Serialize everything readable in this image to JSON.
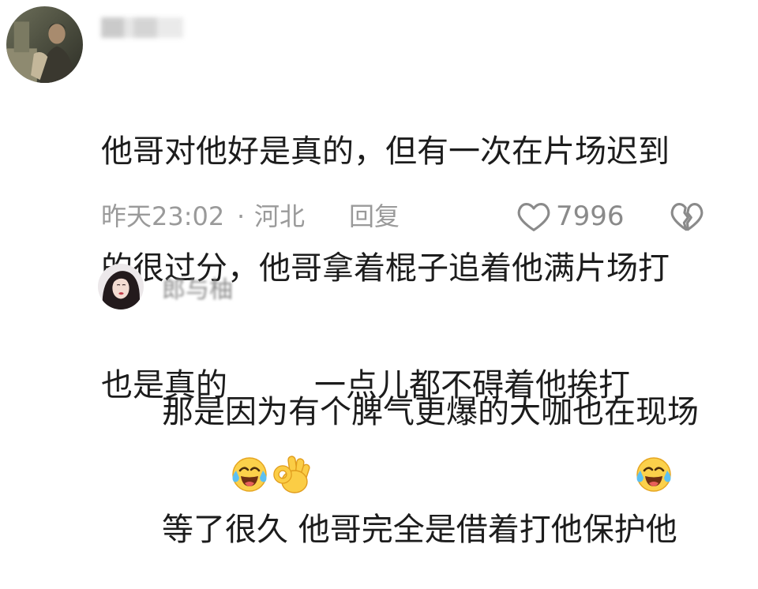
{
  "comments": [
    {
      "avatar_icon": "avatar-photo",
      "lines": [
        "他哥对他好是真的，但有一次在片场迟到",
        "的很过分，他哥拿着棍子追着他满片场打"
      ],
      "last_line": [
        {
          "type": "text",
          "value": "也是真的"
        },
        {
          "type": "emoji",
          "icon": "laughing-crying-emoji"
        },
        {
          "type": "emoji",
          "icon": "ok-hand-emoji"
        },
        {
          "type": "text",
          "value": "一点儿都不碍着他挨打"
        },
        {
          "type": "emoji",
          "icon": "laughing-crying-emoji"
        }
      ],
      "time": "昨天23:02",
      "separator": "·",
      "location": "河北",
      "reply_label": "回复",
      "like_count": "7996",
      "icons": {
        "like": "heart-outline-icon",
        "dislike": "broken-heart-icon"
      }
    },
    {
      "avatar_icon": "avatar-photo",
      "username": "郎与柚",
      "lines": [
        "那是因为有个脾气更爆的大咖也在现场",
        "等了很久 他哥完全是借着打他保护他"
      ]
    }
  ],
  "colors": {
    "text": "#1c1c1c",
    "meta": "#9a9a9a",
    "emoji_yellow": "#fbd14b",
    "tear_blue": "#5cc0f2"
  }
}
